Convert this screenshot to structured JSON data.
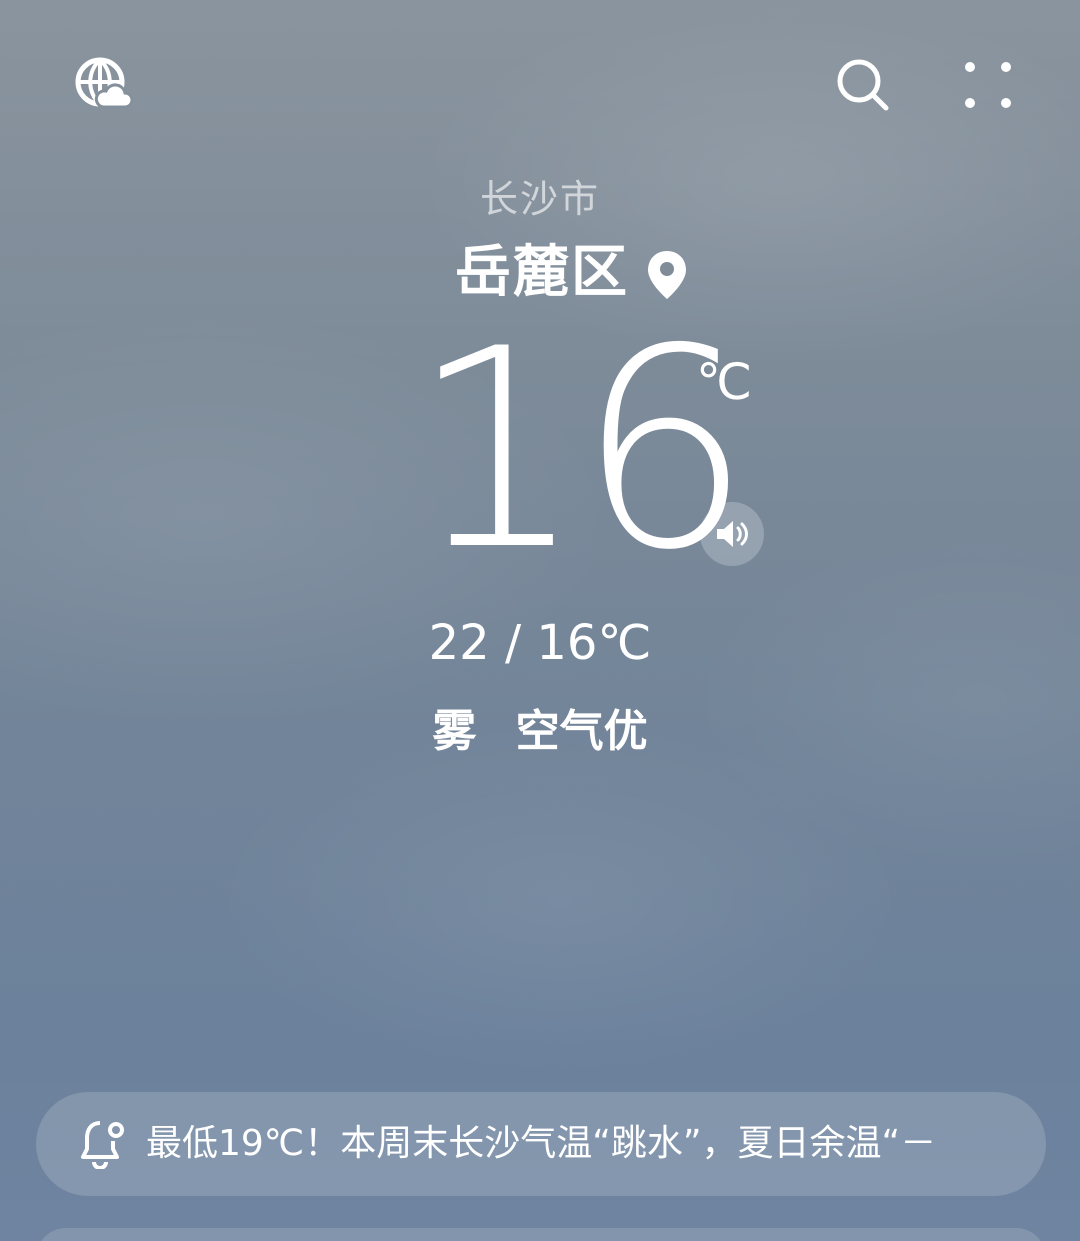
{
  "header": {
    "globe_icon": "globe-cloud-icon",
    "search_icon": "search-icon",
    "more_icon": "four-dots-icon"
  },
  "location": {
    "city": "长沙市",
    "district": "岳麓区"
  },
  "current": {
    "temperature": "16",
    "unit": "℃"
  },
  "today": {
    "range": "22 / 16℃",
    "weather": "雾",
    "air_quality": "空气优"
  },
  "news": {
    "text": "最低19℃！本周末长沙气温“跳水”，夏日余温“－"
  }
}
